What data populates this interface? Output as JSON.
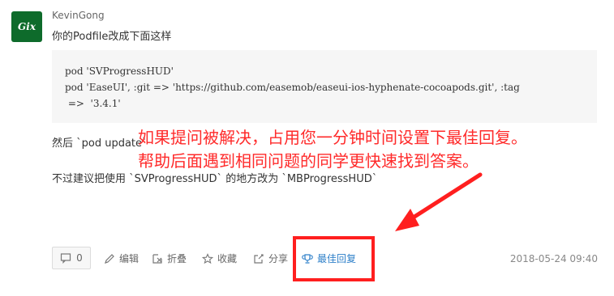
{
  "user": {
    "avatar_text": "Gix",
    "name": "KevinGong"
  },
  "intro": "你的Podfile改成下面这样",
  "code_lines": [
    "pod 'SVProgressHUD'",
    "pod 'EaseUI', :git => 'https://github.com/easemob/easeui-ios-hyphenate-cocoapods.git', :tag",
    " =>  '3.4.1'"
  ],
  "para1": "然后 `pod update`",
  "para2": "不过建议把使用 `SVProgressHUD` 的地方改为 `MBProgressHUD`",
  "annotation": {
    "line1": "如果提问被解决，占用您一分钟时间设置下最佳回复。",
    "line2": "帮助后面遇到相同问题的同学更快速找到答案。",
    "color": "#ff2a2a"
  },
  "actions": {
    "vote_count": "0",
    "edit": "编辑",
    "collapse": "折叠",
    "favorite": "收藏",
    "share": "分享",
    "best_answer": "最佳回复"
  },
  "timestamp": "2018-05-24 09:40",
  "colors": {
    "accent": "#2f80c9",
    "highlight": "#ff1f1f"
  }
}
